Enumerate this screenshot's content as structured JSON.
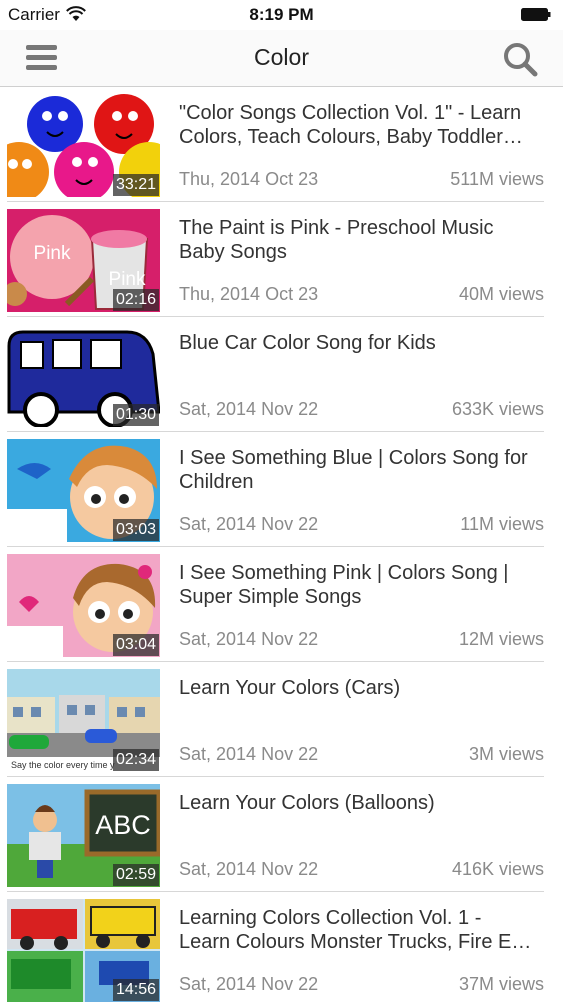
{
  "status_bar": {
    "carrier": "Carrier",
    "time": "8:19 PM",
    "wifi_icon": "wifi-icon",
    "battery_icon": "battery-icon"
  },
  "nav_bar": {
    "title": "Color",
    "menu_icon": "hamburger-menu-icon",
    "search_icon": "search-icon"
  },
  "videos": [
    {
      "title_lines": [
        "\"Color Songs Collection Vol. 1\" - Learn",
        "Colors, Teach Colours, Baby Toddler…"
      ],
      "duration": "33:21",
      "date": "Thu, 2014 Oct 23",
      "views": "511M views"
    },
    {
      "title_lines": [
        "The Paint is Pink - Preschool Music",
        "Baby Songs"
      ],
      "duration": "02:16",
      "date": "Thu, 2014 Oct 23",
      "views": "40M views",
      "thumb_text": [
        "Pink",
        "Pink"
      ]
    },
    {
      "title_lines": [
        "Blue Car Color Song for Kids"
      ],
      "duration": "01:30",
      "date": "Sat, 2014 Nov 22",
      "views": "633K views"
    },
    {
      "title_lines": [
        "I See Something Blue | Colors Song for",
        "Children"
      ],
      "duration": "03:03",
      "date": "Sat, 2014 Nov 22",
      "views": "11M views"
    },
    {
      "title_lines": [
        "I See Something Pink | Colors Song |",
        "Super Simple Songs"
      ],
      "duration": "03:04",
      "date": "Sat, 2014 Nov 22",
      "views": "12M views"
    },
    {
      "title_lines": [
        "Learn Your Colors (Cars)"
      ],
      "duration": "02:34",
      "date": "Sat, 2014 Nov 22",
      "views": "3M views",
      "thumb_text": [
        "Say the color every time y"
      ]
    },
    {
      "title_lines": [
        "Learn Your Colors (Balloons)"
      ],
      "duration": "02:59",
      "date": "Sat, 2014 Nov 22",
      "views": "416K views",
      "thumb_text": [
        "ABC"
      ]
    },
    {
      "title_lines": [
        "Learning Colors Collection Vol. 1 -",
        "Learn Colours Monster Trucks, Fire E…"
      ],
      "duration": "14:56",
      "date": "Sat, 2014 Nov 22",
      "views": "37M views"
    }
  ]
}
